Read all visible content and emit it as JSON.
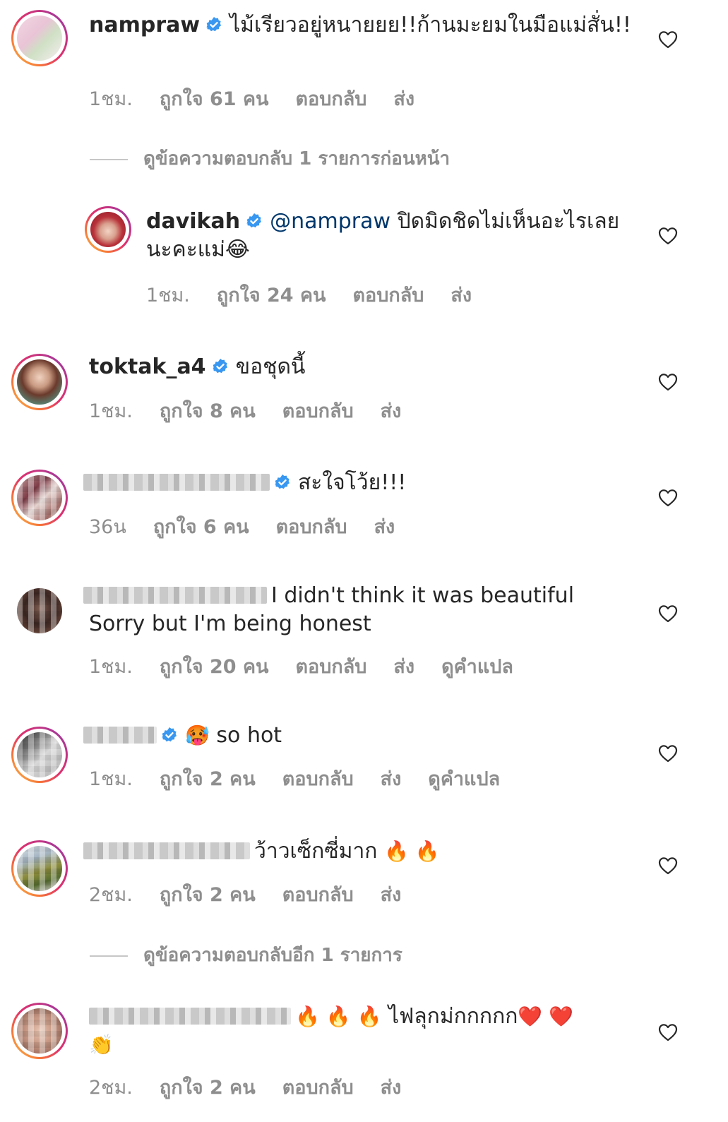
{
  "colors": {
    "text": "#262626",
    "secondary": "#8e8e8e",
    "mention": "#00376b",
    "verified": "#3897f0",
    "story_ring": "#e1306c"
  },
  "comments": [
    {
      "username": "nampraw",
      "text": "ไม้เรียวอยู่หนายยย!!ก้านมะยมในมือแม่สั่น!!",
      "time": "1ชม.",
      "likes": "ถูกใจ 61 คน",
      "reply": "ตอบกลับ",
      "send": "ส่ง"
    },
    {
      "view_previous": "ดูข้อความตอบกลับ 1 รายการก่อนหน้า"
    },
    {
      "username": "davikah",
      "mention": "@nampraw",
      "text": "ปิดมิดชิดไม่เห็นอะไรเลยนะคะแม่😂",
      "time": "1ชม.",
      "likes": "ถูกใจ 24 คน",
      "reply": "ตอบกลับ",
      "send": "ส่ง"
    },
    {
      "username": "toktak_a4",
      "text": "ขอชุดนี้",
      "time": "1ชม.",
      "likes": "ถูกใจ 8 คน",
      "reply": "ตอบกลับ",
      "send": "ส่ง"
    },
    {
      "text": "สะใจโว้ย!!!",
      "time": "36น",
      "likes": "ถูกใจ 6 คน",
      "reply": "ตอบกลับ",
      "send": "ส่ง"
    },
    {
      "text_line1": "I didn't think it was beautiful",
      "text_line2": "Sorry but I'm being honest",
      "time": "1ชม.",
      "likes": "ถูกใจ 20 คน",
      "reply": "ตอบกลับ",
      "send": "ส่ง",
      "translate": "ดูคำแปล"
    },
    {
      "emoji": "🥵",
      "text": "so hot",
      "time": "1ชม.",
      "likes": "ถูกใจ 2 คน",
      "reply": "ตอบกลับ",
      "send": "ส่ง",
      "translate": "ดูคำแปล"
    },
    {
      "text": "ว้าวเซ็กซี่มาก",
      "emoji": "🔥 🔥",
      "time": "2ชม.",
      "likes": "ถูกใจ 2 คน",
      "reply": "ตอบกลับ",
      "send": "ส่ง"
    },
    {
      "view_more": "ดูข้อความตอบกลับอีก 1 รายการ"
    },
    {
      "emoji_lead": "🔥 🔥 🔥",
      "text": "ไฟลุกม่กกกกก",
      "emoji_trail": "❤️ ❤️",
      "emoji_line2": "👏",
      "time": "2ชม.",
      "likes": "ถูกใจ 2 คน",
      "reply": "ตอบกลับ",
      "send": "ส่ง"
    }
  ]
}
